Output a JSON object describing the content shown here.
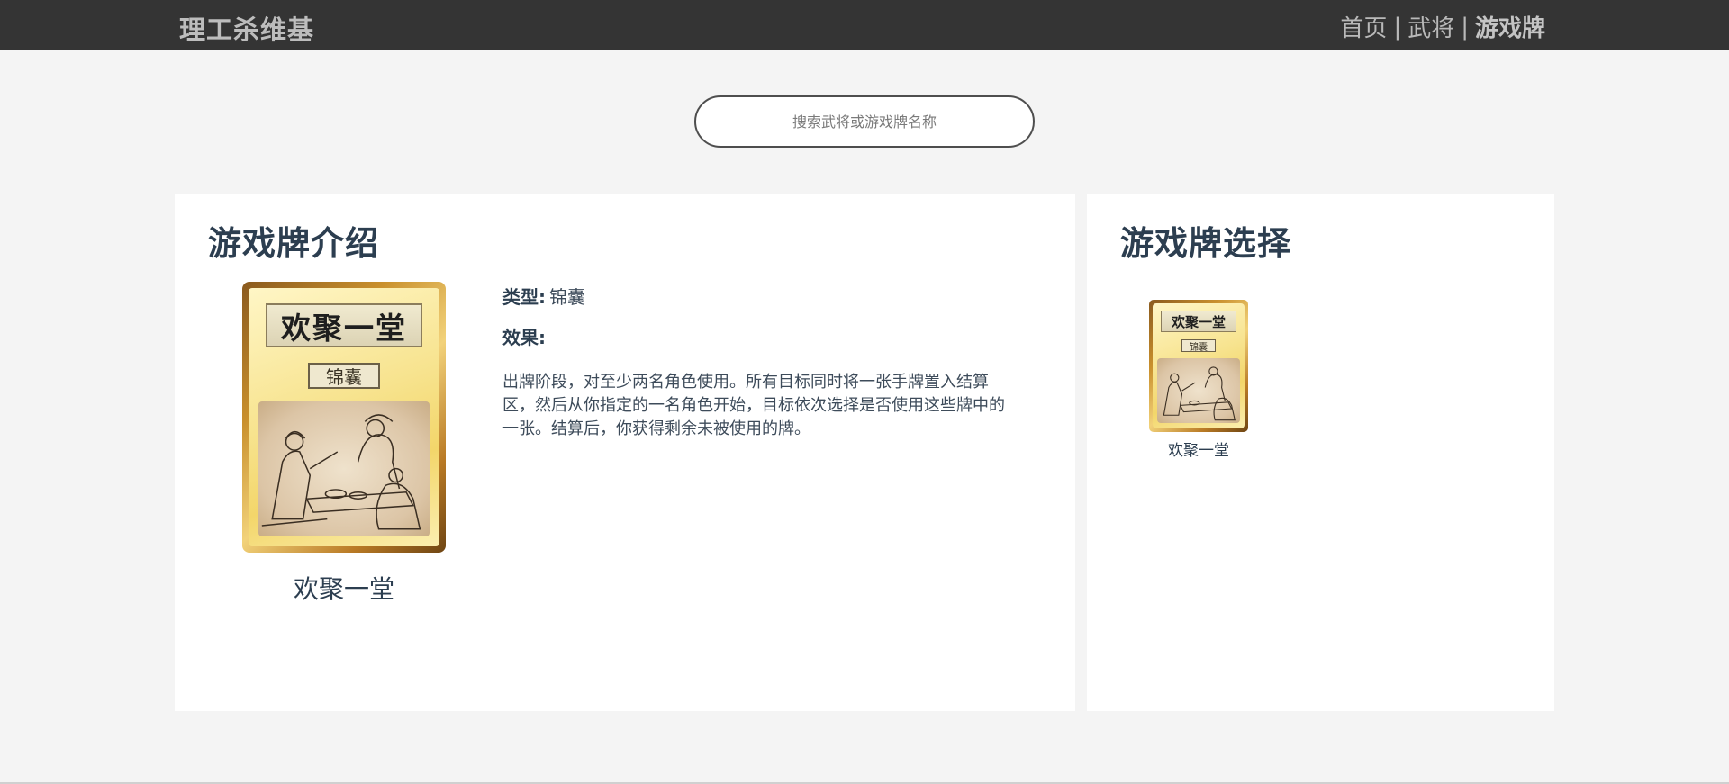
{
  "header": {
    "brand": "理工杀维基",
    "nav": [
      {
        "label": "首页",
        "active": false
      },
      {
        "label": "武将",
        "active": false
      },
      {
        "label": "游戏牌",
        "active": true
      }
    ],
    "separator": "|"
  },
  "search": {
    "placeholder": "搜索武将或游戏牌名称",
    "value": ""
  },
  "intro": {
    "title": "游戏牌介绍",
    "card": {
      "name": "欢聚一堂",
      "art_title": "欢聚一堂",
      "art_type": "锦囊"
    },
    "type_label": "类型:",
    "type_value": "锦囊",
    "effect_label": "效果:",
    "effect_text": "出牌阶段，对至少两名角色使用。所有目标同时将一张手牌置入结算区，然后从你指定的一名角色开始，目标依次选择是否使用这些牌中的一张。结算后，你获得剩余未被使用的牌。"
  },
  "select": {
    "title": "游戏牌选择",
    "cards": [
      {
        "name": "欢聚一堂",
        "art_title": "欢聚一堂",
        "art_type": "锦囊"
      }
    ]
  },
  "colors": {
    "header_bg": "#343434",
    "page_bg": "#f4f4f4",
    "panel_bg": "#ffffff",
    "title_text": "#2c3e50",
    "card_frame": "#c9902d"
  }
}
